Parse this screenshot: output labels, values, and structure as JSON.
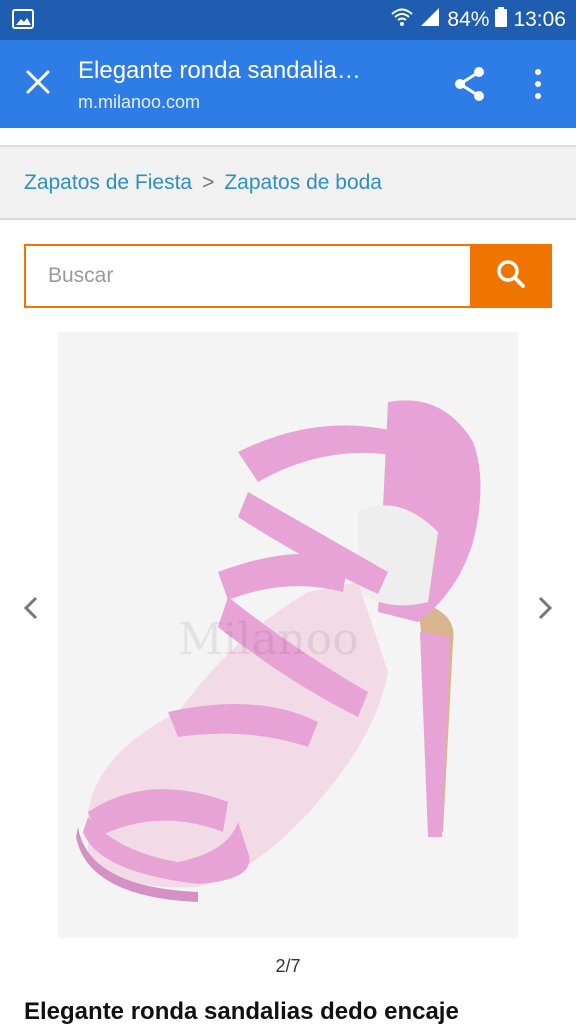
{
  "status_bar": {
    "battery": "84%",
    "time": "13:06"
  },
  "browser": {
    "title": "Elegante ronda sandalia…",
    "url": "m.milanoo.com"
  },
  "breadcrumb": {
    "items": [
      "Zapatos de Fiesta",
      "Zapatos de boda"
    ],
    "separator": ">"
  },
  "search": {
    "placeholder": "Buscar"
  },
  "gallery": {
    "counter": "2/7",
    "watermark": "Milanoo"
  },
  "product": {
    "title": "Elegante ronda sandalias dedo encaje"
  },
  "colors": {
    "status_bar": "#1f5db0",
    "app_bar": "#2e7ce6",
    "accent": "#ef7400",
    "link": "#2f8fc0",
    "shoe": "#e8a3d6"
  }
}
